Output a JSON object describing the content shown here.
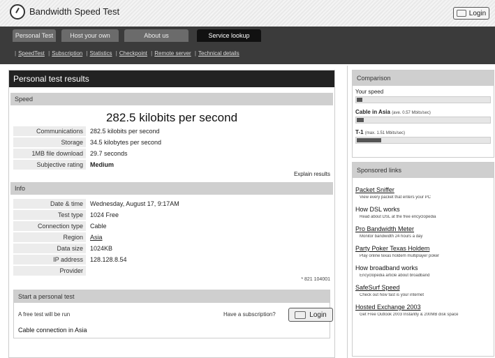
{
  "app": {
    "title": "Bandwidth Speed Test",
    "login_label": "Login"
  },
  "tabs": [
    {
      "label": "Personal Test",
      "active": false
    },
    {
      "label": "Host your own",
      "active": false
    },
    {
      "label": "About us",
      "active": false
    },
    {
      "label": "Service lookup",
      "active": true
    }
  ],
  "subnav": [
    "SpeedTest",
    "Subscription",
    "Statistics",
    "Checkpoint",
    "Remote server",
    "Technical details"
  ],
  "main": {
    "title": "Personal test results",
    "speed_section": {
      "heading": "Speed",
      "big_value": "282.5 kilobits per second",
      "rows": [
        {
          "key": "Communications",
          "value": "282.5 kilobits per second"
        },
        {
          "key": "Storage",
          "value": "34.5 kilobytes per second"
        },
        {
          "key": "1MB file download",
          "value": "29.7 seconds"
        },
        {
          "key": "Subjective rating",
          "value": "Medium"
        }
      ],
      "explain_label": "Explain results"
    },
    "info_section": {
      "heading": "Info",
      "rows": [
        {
          "key": "Date & time",
          "value": "Wednesday, August 17, 9:17AM"
        },
        {
          "key": "Test type",
          "value": "1024 Free"
        },
        {
          "key": "Connection type",
          "value": "Cable"
        },
        {
          "key": "Region",
          "value": "Asia"
        },
        {
          "key": "Data size",
          "value": "1024KB"
        },
        {
          "key": "IP address",
          "value": "128.128.8.54"
        },
        {
          "key": "Provider",
          "value": ""
        }
      ],
      "footnote": "* 821 104001"
    },
    "start": {
      "heading": "Start a personal test",
      "text": "A free test will be run",
      "have_subscription": "Have a subscription?",
      "login_label": "Login",
      "connection_note": "Cable connection in Asia"
    }
  },
  "sidebar": {
    "comparison": {
      "heading": "Comparison",
      "items": [
        {
          "label": "Your speed",
          "note": "",
          "fraction": 0.04
        },
        {
          "label": "Cable in Asia",
          "note": "(ave. 0.57 Mbits/sec)",
          "fraction": 0.05
        },
        {
          "label": "T-1",
          "note": "(max. 1.51 Mbits/sec)",
          "fraction": 0.18
        }
      ]
    },
    "sponsored": {
      "heading": "Sponsored links",
      "links": [
        {
          "title": "Packet Sniffer",
          "desc": "View every packet that enters your PC"
        },
        {
          "title": "How DSL works",
          "desc": "Read about DSL at the free encyclopedia"
        },
        {
          "title": "Pro Bandwidth Meter",
          "desc": "Monitor bandwidth 24 hours a day"
        },
        {
          "title": "Party Poker Texas Holdem",
          "desc": "Play online texas holdem multiplayer poker"
        },
        {
          "title": "How broadband works",
          "desc": "Encyclopedia article about broadband"
        },
        {
          "title": "SafeSurf Speed",
          "desc": "Check out how fast is your internet"
        },
        {
          "title": "Hosted Exchange 2003",
          "desc": "Get Free Outlook 2003 Instantly & 200MB disk space"
        }
      ]
    }
  }
}
